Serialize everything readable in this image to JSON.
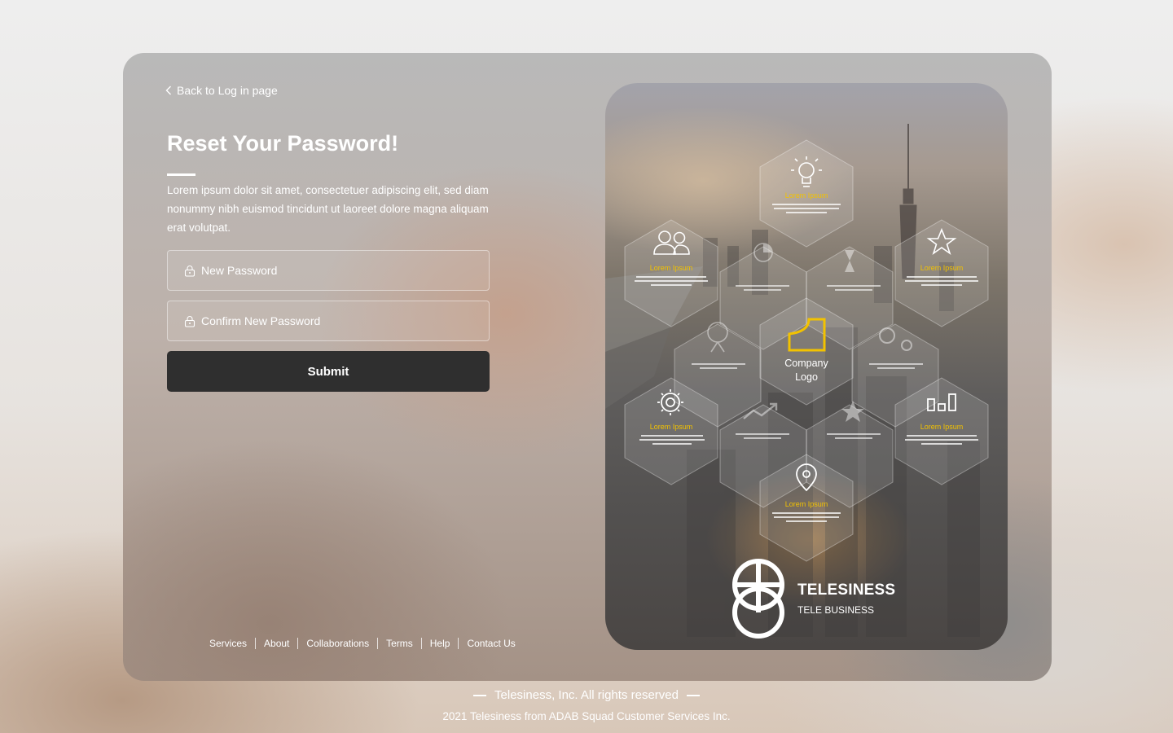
{
  "back_link": {
    "label": "Back to Log in page",
    "icon": "chevron-left-icon"
  },
  "form": {
    "title": "Reset Your Password!",
    "description": "Lorem ipsum dolor sit amet, consectetuer adipiscing elit, sed diam nonummy nibh euismod tincidunt ut laoreet dolore magna aliquam erat volutpat.",
    "new_password": {
      "placeholder": "New Password",
      "value": "",
      "icon": "lock-icon"
    },
    "confirm_password": {
      "placeholder": "Confirm New Password",
      "value": "",
      "icon": "lock-icon"
    },
    "submit_label": "Submit"
  },
  "footer_links": [
    "Services",
    "About",
    "Collaborations",
    "Terms",
    "Help",
    "Contact Us"
  ],
  "infographic": {
    "center_label_line1": "Company",
    "center_label_line2": "Logo",
    "hexes": [
      {
        "title": "Lorem Ipsum",
        "icon": "lightbulb-icon"
      },
      {
        "title": "Lorem Ipsum",
        "icon": "users-icon"
      },
      {
        "title": "Lorem Ipsum",
        "icon": "star-icon"
      },
      {
        "title": "Lorem Ipsum",
        "icon": "gear-icon"
      },
      {
        "title": "Lorem Ipsum",
        "icon": "bar-chart-icon"
      },
      {
        "title": "Lorem Ipsum",
        "icon": "map-pin-icon"
      }
    ]
  },
  "brand": {
    "name": "TELESINESS",
    "tagline": "TELE BUSINESS"
  },
  "copyright": {
    "line1": "Telesiness, Inc. All rights reserved",
    "line2": "2021 Telesiness from ADAB Squad Customer Services Inc."
  },
  "colors": {
    "accent": "#f2c200",
    "button_bg": "#2f2f2f",
    "text": "#ffffff"
  }
}
